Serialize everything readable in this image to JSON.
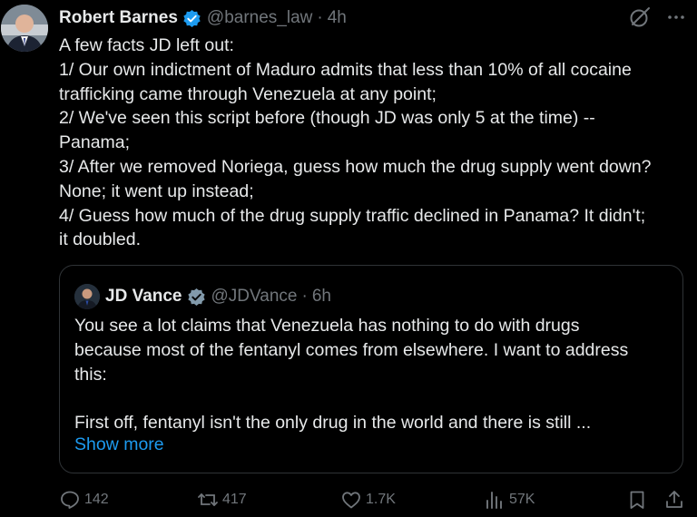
{
  "tweet": {
    "author_name": "Robert Barnes",
    "handle": "@barnes_law",
    "separator": "·",
    "time": "4h",
    "text_lines": [
      "A few facts JD left out:",
      "1/ Our own indictment of Maduro admits that less than 10% of all cocaine",
      "trafficking came through Venezuela at any point;",
      "2/ We've seen this script before (though JD was only 5 at the time) --",
      "Panama;",
      "3/ After we removed Noriega, guess how much the drug supply went down?",
      "None; it went up instead;",
      "4/ Guess how much of the drug supply traffic declined in Panama? It didn't;",
      "it doubled."
    ]
  },
  "quote": {
    "author_name": "JD Vance",
    "handle": "@JDVance",
    "separator": "·",
    "time": "6h",
    "text_lines": [
      "You see a lot claims that Venezuela has nothing to do with drugs",
      "because most of the fentanyl comes from elsewhere. I want to address",
      "this:",
      "",
      "First off, fentanyl isn't the only drug in the world and there is still ..."
    ],
    "show_more": "Show more"
  },
  "actions": {
    "replies": "142",
    "reposts": "417",
    "likes": "1.7K",
    "views": "57K"
  },
  "icons": {
    "verified": "verified-badge-icon",
    "grok": "grok-icon",
    "more": "more-icon",
    "reply": "reply-icon",
    "repost": "repost-icon",
    "like": "like-icon",
    "views": "views-icon",
    "bookmark": "bookmark-icon",
    "share": "share-icon"
  },
  "colors": {
    "background": "#000000",
    "text": "#e7e9ea",
    "muted": "#71767b",
    "accent": "#1d9bf0",
    "border": "#2f3336"
  }
}
